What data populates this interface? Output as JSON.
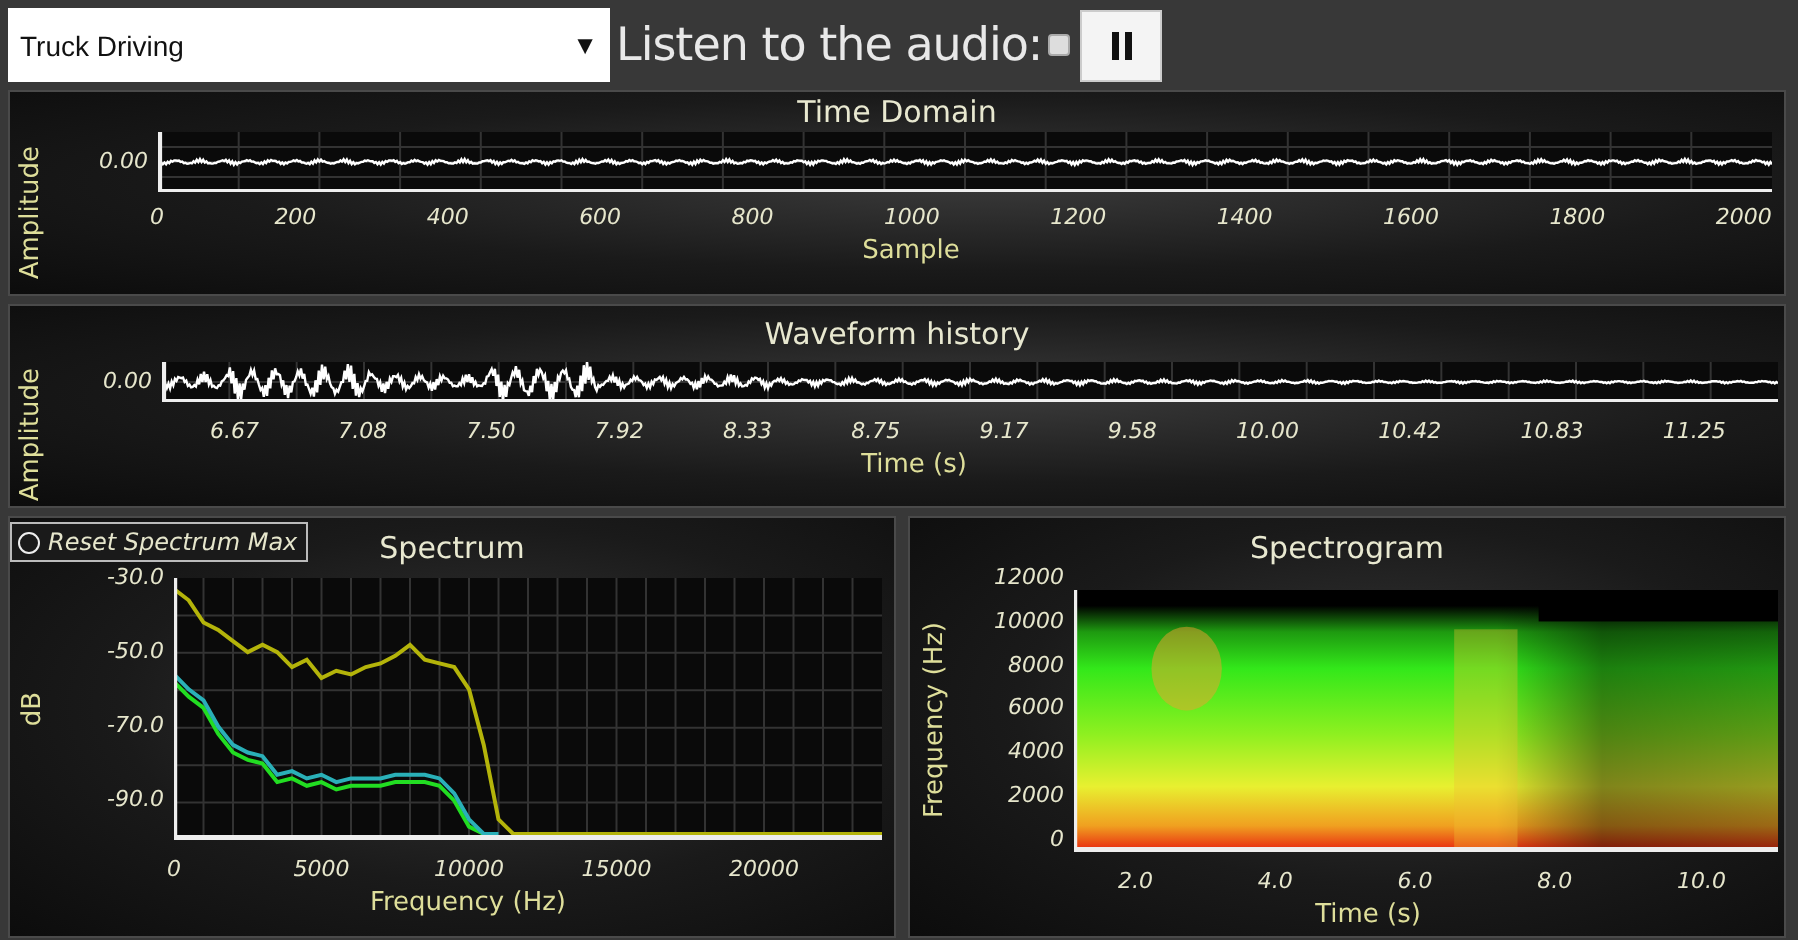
{
  "source_select": {
    "value": "Truck Driving",
    "arrow": "▼"
  },
  "audio": {
    "label": "Listen to the audio:",
    "checked": false
  },
  "time_domain": {
    "title": "Time Domain",
    "ylabel": "Amplitude",
    "y_ticks": [
      "0.00"
    ],
    "x_ticks": [
      "0",
      "200",
      "400",
      "600",
      "800",
      "1000",
      "1200",
      "1400",
      "1600",
      "1800",
      "2000"
    ],
    "xlabel": "Sample"
  },
  "waveform_history": {
    "title": "Waveform history",
    "ylabel": "Amplitude",
    "y_ticks": [
      "0.00"
    ],
    "x_ticks": [
      "6.67",
      "7.08",
      "7.50",
      "7.92",
      "8.33",
      "8.75",
      "9.17",
      "9.58",
      "10.00",
      "10.42",
      "10.83",
      "11.25"
    ],
    "xlabel": "Time (s)"
  },
  "spectrum": {
    "reset_button": {
      "label": "Reset Spectrum Max",
      "checked": false
    },
    "chart_data": {
      "type": "line",
      "title": "Spectrum",
      "xlabel": "Frequency (Hz)",
      "ylabel": "dB",
      "x": [
        0,
        500,
        1000,
        1500,
        2000,
        2500,
        3000,
        3500,
        4000,
        4500,
        5000,
        5500,
        6000,
        6500,
        7000,
        7500,
        8000,
        8500,
        9000,
        9500,
        10000,
        10500,
        11000,
        11500,
        12000,
        24000
      ],
      "series": [
        {
          "color": "#22dd22",
          "values": [
            -58,
            -62,
            -65,
            -72,
            -77,
            -79,
            -80,
            -85,
            -84,
            -86,
            -85,
            -87,
            -86,
            -86,
            -86,
            -85,
            -85,
            -85,
            -86,
            -90,
            -97,
            -99,
            null,
            null,
            null,
            null
          ]
        },
        {
          "color": "#2ab0b8",
          "values": [
            -56,
            -60,
            -63,
            -70,
            -75,
            -77,
            -78,
            -83,
            -82,
            -84,
            -83,
            -85,
            -84,
            -84,
            -84,
            -83,
            -83,
            -83,
            -84,
            -88,
            -95,
            -99,
            -99,
            null,
            null,
            null
          ]
        },
        {
          "color": "#b4b40a",
          "values": [
            -33,
            -36,
            -42,
            -44,
            -47,
            -50,
            -48,
            -50,
            -54,
            -52,
            -57,
            -55,
            -56,
            -54,
            -53,
            -51,
            -48,
            -52,
            -53,
            -54,
            -60,
            -75,
            -95,
            -99,
            -99,
            -99
          ]
        }
      ],
      "grid": true,
      "xlim": [
        0,
        24000
      ],
      "ylim": [
        -100.6,
        -30
      ],
      "xticks": [
        0,
        5000,
        10000,
        15000,
        20000
      ],
      "yticks": [
        {
          "value": -30,
          "label": "-30.0"
        },
        {
          "value": -50,
          "label": "-50.0"
        },
        {
          "value": -70,
          "label": "-70.0"
        },
        {
          "value": -90,
          "label": "-90.0"
        }
      ]
    }
  },
  "spectrogram": {
    "title": "Spectrogram",
    "ylabel": "Frequency (Hz)",
    "y_ticks": [
      "12000",
      "10000",
      "8000",
      "6000",
      "4000",
      "2000",
      "0"
    ],
    "x_ticks": [
      "2.0",
      "4.0",
      "6.0",
      "8.0",
      "10.0"
    ],
    "xlabel": "Time (s)"
  }
}
